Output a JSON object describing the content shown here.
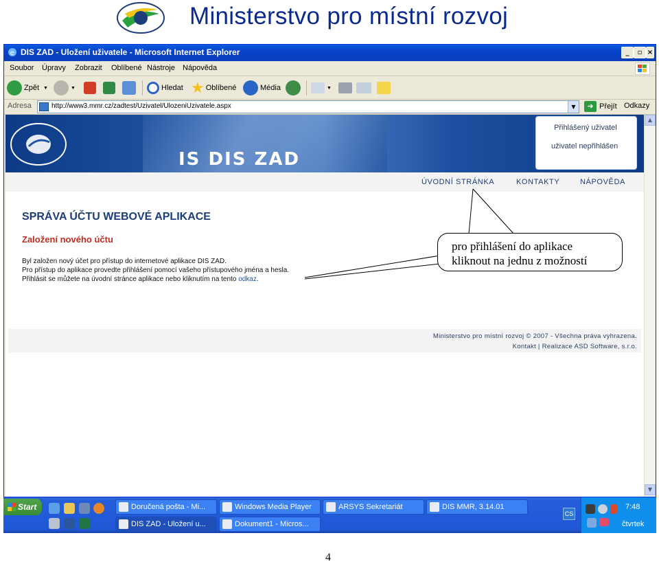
{
  "document": {
    "title": "Ministerstvo pro místní rozvoj",
    "page_number": "4"
  },
  "window": {
    "title": "DIS ZAD - Uložení uživatele - Microsoft Internet Explorer",
    "buttons": [
      "_",
      "▫",
      "×"
    ]
  },
  "menu": [
    "Soubor",
    "Úpravy",
    "Zobrazit",
    "Oblíbené",
    "Nástroje",
    "Nápověda"
  ],
  "toolbar": {
    "back_label": "Zpět",
    "search_label": "Hledat",
    "favorites_label": "Oblíbené",
    "media_label": "Média"
  },
  "address": {
    "label": "Adresa",
    "url": "http://www3.mmr.cz/zadtest/Uzivatel/UlozeniUzivatele.aspx",
    "go_label": "Přejít",
    "links_label": "Odkazy"
  },
  "page": {
    "banner_title": "IS DIS ZAD",
    "user_box": {
      "title": "Přihlášený uživatel",
      "status": "uživatel nepřihlášen"
    },
    "nav": [
      "ÚVODNÍ STRÁNKA",
      "KONTAKTY",
      "NÁPOVĚDA"
    ],
    "heading": "SPRÁVA ÚČTU WEBOVÉ APLIKACE",
    "subheading": "Založení nového účtu",
    "paragraph_lines": [
      "Byl založen nový účet pro přístup do internetové aplikace DIS ZAD.",
      "Pro přístup do aplikace provedte přihlášení pomocí vašeho přístupového jména a hesla.",
      "Přihlásit se můžete na úvodní stránce aplikace nebo kliknutím na tento "
    ],
    "link_text": "odkaz",
    "footer": {
      "line1": "Ministerstvo pro místní rozvoj © 2007 - Všechna práva vyhrazena.",
      "line2": "Kontakt | Realizace ASD Software, s.r.o."
    }
  },
  "callout": {
    "line1": "pro přihlášení do aplikace",
    "line2": "kliknout na jednu z možností"
  },
  "taskbar": {
    "start_label": "Start",
    "row1": [
      "Doručená pošta - Mi...",
      "Windows Media Player",
      "ARSYS Sekretariát",
      "DIS MMR, 3.14.01"
    ],
    "row2": [
      "DIS ZAD - Uložení u...",
      "Dokument1 - Micros..."
    ],
    "lang": "CS",
    "time": "7:48",
    "day": "čtvrtek"
  },
  "colors": {
    "titlebar": "#0842c9",
    "banner": "#1f56a6",
    "heading": "#1c3c7a",
    "subheading": "#c22b1f",
    "link": "#1d4fb7"
  }
}
